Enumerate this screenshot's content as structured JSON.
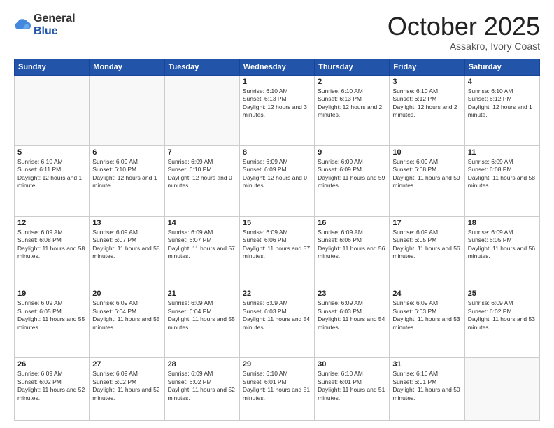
{
  "logo": {
    "general": "General",
    "blue": "Blue"
  },
  "header": {
    "month": "October 2025",
    "location": "Assakro, Ivory Coast"
  },
  "weekdays": [
    "Sunday",
    "Monday",
    "Tuesday",
    "Wednesday",
    "Thursday",
    "Friday",
    "Saturday"
  ],
  "days": {
    "1": {
      "sunrise": "6:10 AM",
      "sunset": "6:13 PM",
      "daylight": "12 hours and 3 minutes."
    },
    "2": {
      "sunrise": "6:10 AM",
      "sunset": "6:13 PM",
      "daylight": "12 hours and 2 minutes."
    },
    "3": {
      "sunrise": "6:10 AM",
      "sunset": "6:12 PM",
      "daylight": "12 hours and 2 minutes."
    },
    "4": {
      "sunrise": "6:10 AM",
      "sunset": "6:12 PM",
      "daylight": "12 hours and 1 minute."
    },
    "5": {
      "sunrise": "6:10 AM",
      "sunset": "6:11 PM",
      "daylight": "12 hours and 1 minute."
    },
    "6": {
      "sunrise": "6:09 AM",
      "sunset": "6:10 PM",
      "daylight": "12 hours and 1 minute."
    },
    "7": {
      "sunrise": "6:09 AM",
      "sunset": "6:10 PM",
      "daylight": "12 hours and 0 minutes."
    },
    "8": {
      "sunrise": "6:09 AM",
      "sunset": "6:09 PM",
      "daylight": "12 hours and 0 minutes."
    },
    "9": {
      "sunrise": "6:09 AM",
      "sunset": "6:09 PM",
      "daylight": "11 hours and 59 minutes."
    },
    "10": {
      "sunrise": "6:09 AM",
      "sunset": "6:08 PM",
      "daylight": "11 hours and 59 minutes."
    },
    "11": {
      "sunrise": "6:09 AM",
      "sunset": "6:08 PM",
      "daylight": "11 hours and 58 minutes."
    },
    "12": {
      "sunrise": "6:09 AM",
      "sunset": "6:08 PM",
      "daylight": "11 hours and 58 minutes."
    },
    "13": {
      "sunrise": "6:09 AM",
      "sunset": "6:07 PM",
      "daylight": "11 hours and 58 minutes."
    },
    "14": {
      "sunrise": "6:09 AM",
      "sunset": "6:07 PM",
      "daylight": "11 hours and 57 minutes."
    },
    "15": {
      "sunrise": "6:09 AM",
      "sunset": "6:06 PM",
      "daylight": "11 hours and 57 minutes."
    },
    "16": {
      "sunrise": "6:09 AM",
      "sunset": "6:06 PM",
      "daylight": "11 hours and 56 minutes."
    },
    "17": {
      "sunrise": "6:09 AM",
      "sunset": "6:05 PM",
      "daylight": "11 hours and 56 minutes."
    },
    "18": {
      "sunrise": "6:09 AM",
      "sunset": "6:05 PM",
      "daylight": "11 hours and 56 minutes."
    },
    "19": {
      "sunrise": "6:09 AM",
      "sunset": "6:05 PM",
      "daylight": "11 hours and 55 minutes."
    },
    "20": {
      "sunrise": "6:09 AM",
      "sunset": "6:04 PM",
      "daylight": "11 hours and 55 minutes."
    },
    "21": {
      "sunrise": "6:09 AM",
      "sunset": "6:04 PM",
      "daylight": "11 hours and 55 minutes."
    },
    "22": {
      "sunrise": "6:09 AM",
      "sunset": "6:03 PM",
      "daylight": "11 hours and 54 minutes."
    },
    "23": {
      "sunrise": "6:09 AM",
      "sunset": "6:03 PM",
      "daylight": "11 hours and 54 minutes."
    },
    "24": {
      "sunrise": "6:09 AM",
      "sunset": "6:03 PM",
      "daylight": "11 hours and 53 minutes."
    },
    "25": {
      "sunrise": "6:09 AM",
      "sunset": "6:02 PM",
      "daylight": "11 hours and 53 minutes."
    },
    "26": {
      "sunrise": "6:09 AM",
      "sunset": "6:02 PM",
      "daylight": "11 hours and 52 minutes."
    },
    "27": {
      "sunrise": "6:09 AM",
      "sunset": "6:02 PM",
      "daylight": "11 hours and 52 minutes."
    },
    "28": {
      "sunrise": "6:09 AM",
      "sunset": "6:02 PM",
      "daylight": "11 hours and 52 minutes."
    },
    "29": {
      "sunrise": "6:10 AM",
      "sunset": "6:01 PM",
      "daylight": "11 hours and 51 minutes."
    },
    "30": {
      "sunrise": "6:10 AM",
      "sunset": "6:01 PM",
      "daylight": "11 hours and 51 minutes."
    },
    "31": {
      "sunrise": "6:10 AM",
      "sunset": "6:01 PM",
      "daylight": "11 hours and 50 minutes."
    }
  }
}
